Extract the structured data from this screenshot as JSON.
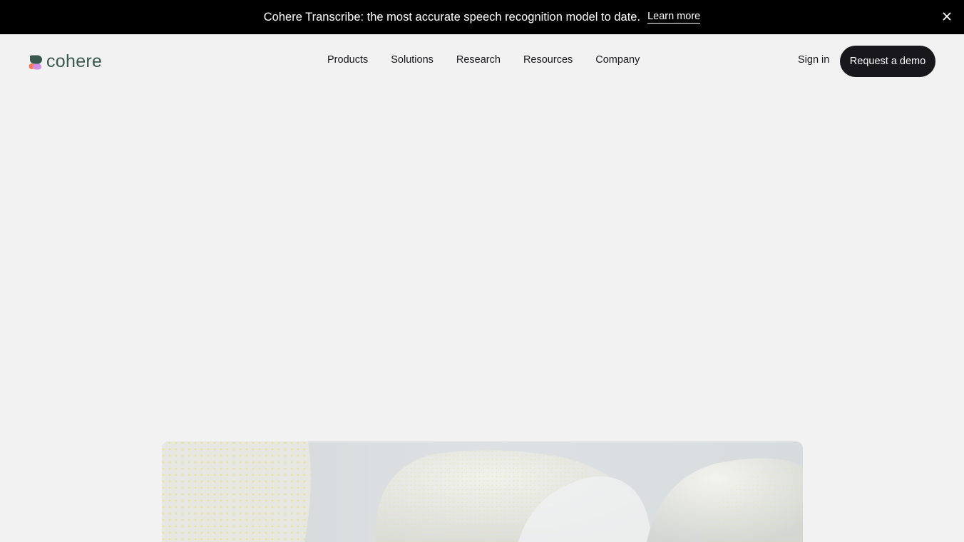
{
  "announcement": {
    "message": "Cohere Transcribe: the most accurate speech recognition model to date.",
    "link_label": "Learn more",
    "close_icon": "close-icon"
  },
  "header": {
    "logo_text": "cohere",
    "nav": [
      {
        "label": "Products"
      },
      {
        "label": "Solutions"
      },
      {
        "label": "Research"
      },
      {
        "label": "Resources"
      },
      {
        "label": "Company"
      }
    ],
    "sign_in_label": "Sign in",
    "demo_button_label": "Request a demo"
  },
  "colors": {
    "background": "#f2f2f2",
    "announcement_bg": "#000000",
    "brand_green": "#39594d",
    "button_dark": "#17171c",
    "logo_coral": "#ff7759",
    "logo_purple": "#d18ee2"
  },
  "hero_image": {
    "description_icon": "abstract-3d-shapes-image"
  }
}
